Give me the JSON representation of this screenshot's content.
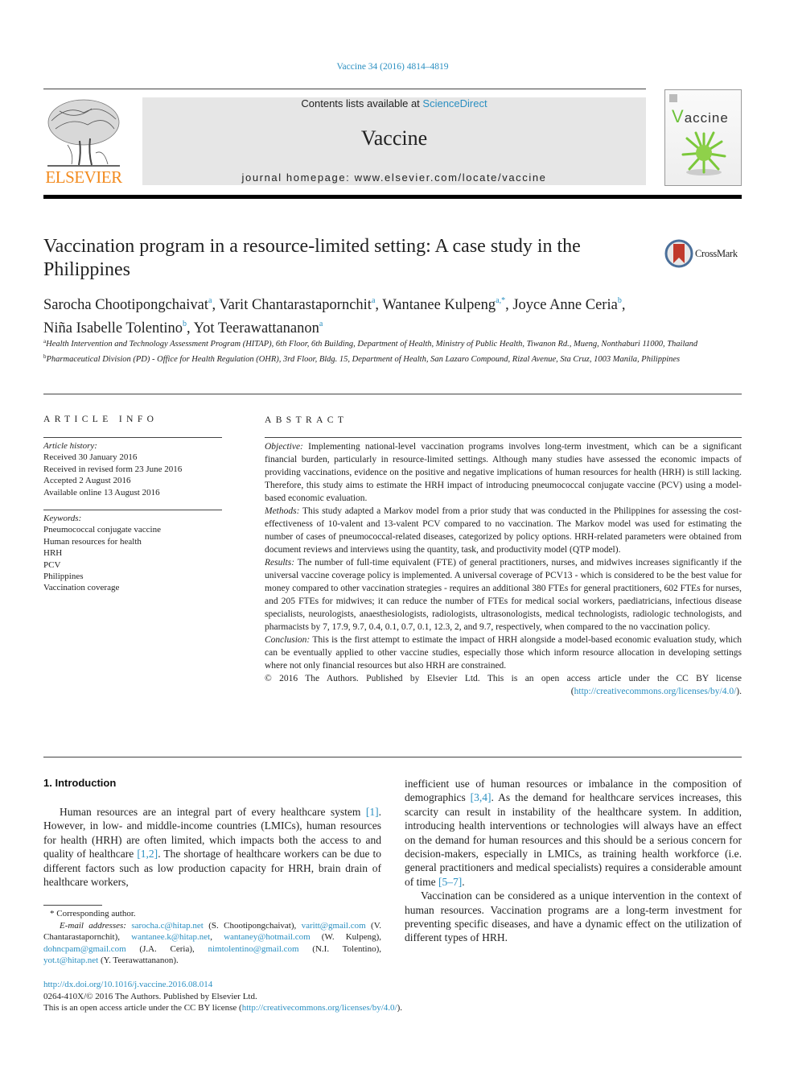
{
  "header": {
    "journal_ref": "Vaccine 34 (2016) 4814–4819",
    "contents_prefix": "Contents lists available at ",
    "contents_link": "ScienceDirect",
    "journal_name": "Vaccine",
    "homepage": "journal homepage: www.elsevier.com/locate/vaccine",
    "publisher_logo_text": "ELSEVIER",
    "cover_title_v": "V",
    "cover_title_rest": "accine",
    "brand_color": "#f28a1d",
    "link_color": "#2a8fc1",
    "cover_accent": "#6cc23a"
  },
  "title": {
    "text": "Vaccination program in a resource-limited setting: A case study in the Philippines",
    "crossmark_label": "CrossMark"
  },
  "authors": [
    {
      "name": "Sarocha Chootipongchaivat",
      "sup": "a",
      "sep": ", "
    },
    {
      "name": "Varit Chantarastapornchit",
      "sup": "a",
      "sep": ", "
    },
    {
      "name": "Wantanee Kulpeng",
      "sup": "a,*",
      "sep": ", "
    },
    {
      "name": "Joyce Anne Ceria",
      "sup": "b",
      "sep": ","
    },
    {
      "name": "Niña Isabelle Tolentino",
      "sup": "b",
      "sep": ", "
    },
    {
      "name": "Yot Teerawattananon",
      "sup": "a",
      "sep": ""
    }
  ],
  "affiliations": [
    {
      "sup": "a",
      "text": "Health Intervention and Technology Assessment Program (HITAP), 6th Floor, 6th Building, Department of Health, Ministry of Public Health, Tiwanon Rd., Mueng, Nonthaburi 11000, Thailand"
    },
    {
      "sup": "b",
      "text": "Pharmaceutical Division (PD) - Office for Health Regulation (OHR), 3rd Floor, Bldg. 15, Department of Health, San Lazaro Compound, Rizal Avenue, Sta Cruz, 1003 Manila, Philippines"
    }
  ],
  "article_info": {
    "heading": "ARTICLE INFO",
    "history_label": "Article history:",
    "history": [
      "Received 30 January 2016",
      "Received in revised form 23 June 2016",
      "Accepted 2 August 2016",
      "Available online 13 August 2016"
    ],
    "keywords_label": "Keywords:",
    "keywords": [
      "Pneumococcal conjugate vaccine",
      "Human resources for health",
      "HRH",
      "PCV",
      "Philippines",
      "Vaccination coverage"
    ]
  },
  "abstract": {
    "heading": "ABSTRACT",
    "sections": [
      {
        "label": "Objective:",
        "text": "Implementing national-level vaccination programs involves long-term investment, which can be a significant financial burden, particularly in resource-limited settings. Although many studies have assessed the economic impacts of providing vaccinations, evidence on the positive and negative implications of human resources for health (HRH) is still lacking. Therefore, this study aims to estimate the HRH impact of introducing pneumococcal conjugate vaccine (PCV) using a model-based economic evaluation."
      },
      {
        "label": "Methods:",
        "text": "This study adapted a Markov model from a prior study that was conducted in the Philippines for assessing the cost-effectiveness of 10-valent and 13-valent PCV compared to no vaccination. The Markov model was used for estimating the number of cases of pneumococcal-related diseases, categorized by policy options. HRH-related parameters were obtained from document reviews and interviews using the quantity, task, and productivity model (QTP model)."
      },
      {
        "label": "Results:",
        "text": "The number of full-time equivalent (FTE) of general practitioners, nurses, and midwives increases significantly if the universal vaccine coverage policy is implemented. A universal coverage of PCV13 - which is considered to be the best value for money compared to other vaccination strategies - requires an additional 380 FTEs for general practitioners, 602 FTEs for nurses, and 205 FTEs for midwives; it can reduce the number of FTEs for medical social workers, paediatricians, infectious disease specialists, neurologists, anaesthesiologists, radiologists, ultrasonologists, medical technologists, radiologic technologists, and pharmacists by 7, 17.9, 9.7, 0.4, 0.1, 0.7, 0.1, 12.3, 2, and 9.7, respectively, when compared to the no vaccination policy."
      },
      {
        "label": "Conclusion:",
        "text": "This is the first attempt to estimate the impact of HRH alongside a model-based economic evaluation study, which can be eventually applied to other vaccine studies, especially those which inform resource allocation in developing settings where not only financial resources but also HRH are constrained."
      }
    ],
    "copyright_text": "© 2016 The Authors. Published by Elsevier Ltd. This is an open access article under the CC BY license (",
    "copyright_link": "http://creativecommons.org/licenses/by/4.0/",
    "copyright_end": ")."
  },
  "intro": {
    "heading": "1. Introduction",
    "left_parts": [
      "Human resources are an integral part of every healthcare system ",
      "[1]",
      ". However, in low- and middle-income countries (LMICs), human resources for health (HRH) are often limited, which impacts both the access to and quality of healthcare ",
      "[1,2]",
      ". The shortage of healthcare workers can be due to different factors such as low production capacity for HRH, brain drain of healthcare workers,"
    ],
    "right_p1_parts": [
      "inefficient use of human resources or imbalance in the composition of demographics ",
      "[3,4]",
      ". As the demand for healthcare services increases, this scarcity can result in instability of the healthcare system. In addition, introducing health interventions or technologies will always have an effect on the demand for human resources and this should be a serious concern for decision-makers, especially in LMICs, as training health workforce (i.e. general practitioners and medical specialists) requires a considerable amount of time ",
      "[5–7]",
      "."
    ],
    "right_p2": "Vaccination can be considered as a unique intervention in the context of human resources. Vaccination programs are a long-term investment for preventing specific diseases, and have a dynamic effect on the utilization of different types of HRH."
  },
  "footnotes": {
    "corresponding": "* Corresponding author.",
    "emails_label": "E-mail addresses:",
    "emails": [
      {
        "email": "sarocha.c@hitap.net",
        "who": " (S. Chootipongchaivat), "
      },
      {
        "email": "varitt@gmail.com",
        "who": " (V. Chantarastapornchit), "
      },
      {
        "email": "wantanee.k@hitap.net",
        "who": ", "
      },
      {
        "email": "wantaney@hotmail.com",
        "who": " (W. Kulpeng), "
      },
      {
        "email": "dohncpam@gmail.com",
        "who": " (J.A. Ceria), "
      },
      {
        "email": "nimtolentino@gmail.com",
        "who": " (N.I. Tolentino), "
      },
      {
        "email": "yot.t@hitap.net",
        "who": " (Y. Teerawattananon)."
      }
    ]
  },
  "doi_block": {
    "doi": "http://dx.doi.org/10.1016/j.vaccine.2016.08.014",
    "issn_line": "0264-410X/© 2016 The Authors. Published by Elsevier Ltd.",
    "license_prefix": "This is an open access article under the CC BY license (",
    "license_link": "http://creativecommons.org/licenses/by/4.0/",
    "license_suffix": ")."
  }
}
